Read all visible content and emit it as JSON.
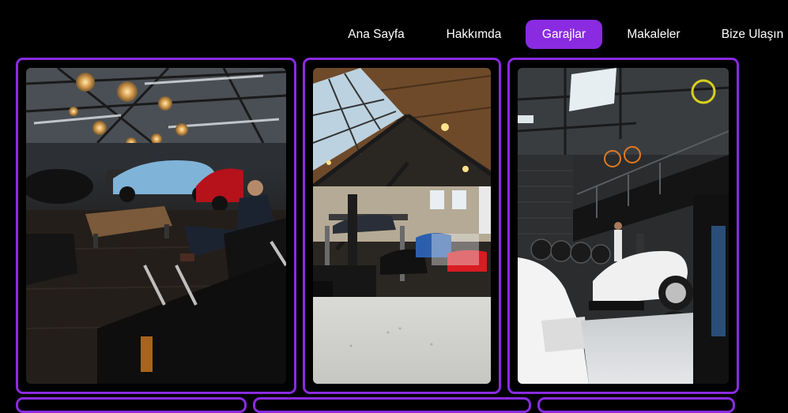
{
  "nav": {
    "items": [
      {
        "label": "Ana Sayfa",
        "active": false
      },
      {
        "label": "Hakkımda",
        "active": false
      },
      {
        "label": "Garajlar",
        "active": true
      },
      {
        "label": "Makaleler",
        "active": false
      },
      {
        "label": "Bize Ulaşın",
        "active": false
      }
    ]
  },
  "colors": {
    "background": "#000000",
    "accent": "#8a2be2",
    "nav_text": "#ffffff"
  },
  "gallery": {
    "cards": [
      {
        "image": "luxury-lounge-garage-photo",
        "description_visible": false
      },
      {
        "image": "skylight-workshop-garage-photo",
        "description_visible": false
      },
      {
        "image": "loft-tuner-garage-photo",
        "description_visible": false
      }
    ]
  }
}
